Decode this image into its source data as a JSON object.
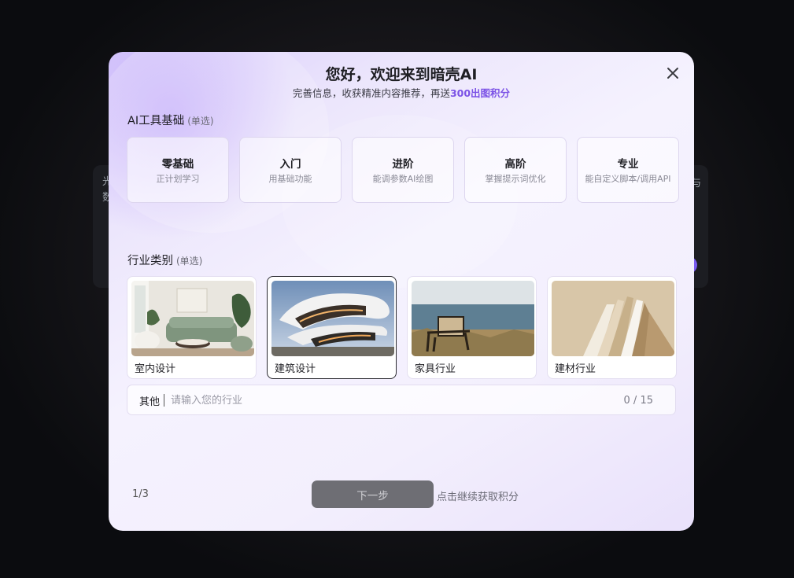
{
  "background": {
    "left_text": "光数",
    "right_text": "与"
  },
  "modal": {
    "title": "您好，欢迎来到暗壳AI",
    "subtitle_prefix": "完善信息，收获精准内容推荐，再送",
    "subtitle_accent": "300出图积分",
    "accent_color": "#7b52e6"
  },
  "ai_level": {
    "heading": "AI工具基础",
    "hint": "(单选)",
    "options": [
      {
        "name": "零基础",
        "desc": "正计划学习"
      },
      {
        "name": "入门",
        "desc": "用基础功能"
      },
      {
        "name": "进阶",
        "desc": "能调参数AI绘图"
      },
      {
        "name": "高阶",
        "desc": "掌握提示词优化"
      },
      {
        "name": "专业",
        "desc": "能自定义脚本/调用API"
      }
    ]
  },
  "industry": {
    "heading": "行业类别",
    "hint": "(单选)",
    "options": [
      {
        "name": "室内设计",
        "image": "living-room-photo",
        "selected": false
      },
      {
        "name": "建筑设计",
        "image": "curved-building-photo",
        "selected": true
      },
      {
        "name": "家具行业",
        "image": "chair-by-sea-photo",
        "selected": false
      },
      {
        "name": "建材行业",
        "image": "material-panels-photo",
        "selected": false
      }
    ],
    "other_label": "其他",
    "other_placeholder": "请输入您的行业",
    "other_value": "",
    "other_count": "0 / 15"
  },
  "footer": {
    "page": "1/3",
    "next_label": "下一步",
    "next_hint": "点击继续获取积分"
  }
}
